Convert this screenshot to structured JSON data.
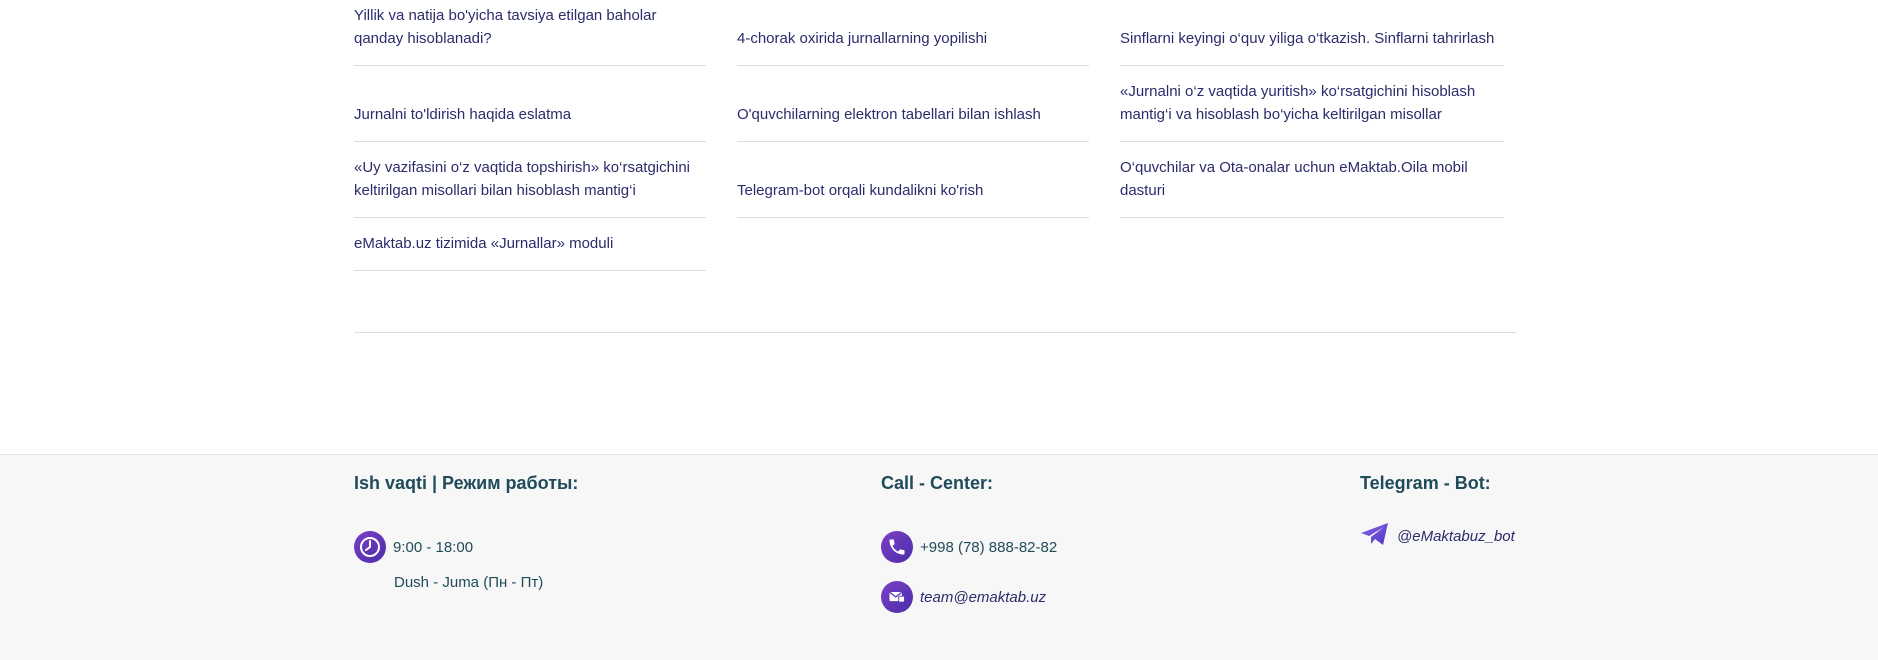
{
  "articles": {
    "col1": [
      {
        "line1": "Yillik va natija bo'yicha tavsiya etilgan baholar",
        "line2": "qanday hisoblanadi?"
      },
      {
        "line1": "Jurnalni to'ldirish haqida eslatma",
        "line2": ""
      },
      {
        "line1": "«Uy vazifasini o‘z vaqtida topshirish» ko‘rsatgichini",
        "line2": "keltirilgan misollari bilan hisoblash mantig‘i"
      },
      {
        "line1": "eMaktab.uz tizimida «Jurnallar» moduli",
        "line2": ""
      }
    ],
    "col2": [
      {
        "line1": "4-chorak oxirida jurnallarning yopilishi",
        "line2": ""
      },
      {
        "line1": "O'quvchilarning elektron tabellari bilan ishlash",
        "line2": ""
      },
      {
        "line1": "Telegram-bot orqali kundalikni ko'rish",
        "line2": ""
      }
    ],
    "col3": [
      {
        "line1": "Sinflarni keyingi o‘quv yiliga o‘tkazish. Sinflarni tahrirlash",
        "line2": ""
      },
      {
        "line1": "«Jurnalni o‘z vaqtida yuritish» ko‘rsatgichini hisoblash",
        "line2": "mantig‘i va hisoblash bo‘yicha keltirilgan misollar"
      },
      {
        "line1": "O‘quvchilar va Ota-onalar uchun eMaktab.Oila mobil",
        "line2": "dasturi"
      }
    ]
  },
  "footer": {
    "hours": {
      "title": "Ish vaqti | Режим работы:",
      "time": "9:00 - 18:00",
      "days": "Dush - Juma (Пн - Пт)",
      "icon": "clock-icon"
    },
    "call_center": {
      "title": "Call - Center:",
      "phone": "+998 (78) 888-82-82",
      "email": "team@emaktab.uz",
      "phone_icon": "phone-icon",
      "email_icon": "mail-icon"
    },
    "telegram": {
      "title": "Telegram - Bot:",
      "handle": "@eMaktabuz_bot",
      "icon": "telegram-icon"
    }
  },
  "colors": {
    "link_text": "#2b2c6b",
    "footer_title": "#1f4b5a",
    "accent_gradient_start": "#7b3fc7",
    "accent_gradient_end": "#4a2ea8",
    "footer_bg": "#f7f7f7"
  }
}
